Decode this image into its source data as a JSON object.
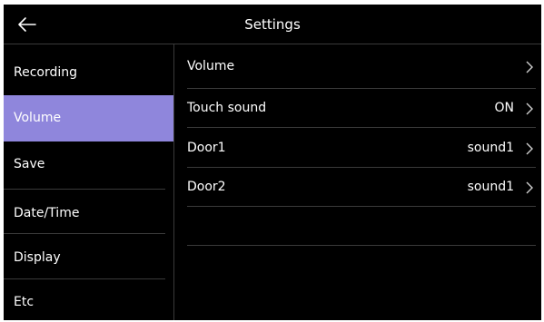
{
  "header": {
    "title": "Settings",
    "back_icon": "arrow-left-icon"
  },
  "sidebar": {
    "items": [
      {
        "label": "Recording"
      },
      {
        "label": "Volume",
        "active": true
      },
      {
        "label": "Save"
      },
      {
        "label": "Date/Time"
      },
      {
        "label": "Display"
      },
      {
        "label": "Etc"
      }
    ],
    "active_color": "#8f86dc"
  },
  "main": {
    "rows": [
      {
        "label": "Volume",
        "value": ""
      },
      {
        "label": "Touch sound",
        "value": "ON"
      },
      {
        "label": "Door1",
        "value": "sound1"
      },
      {
        "label": "Door2",
        "value": "sound1"
      }
    ],
    "chevron_icon": "chevron-right-icon"
  }
}
